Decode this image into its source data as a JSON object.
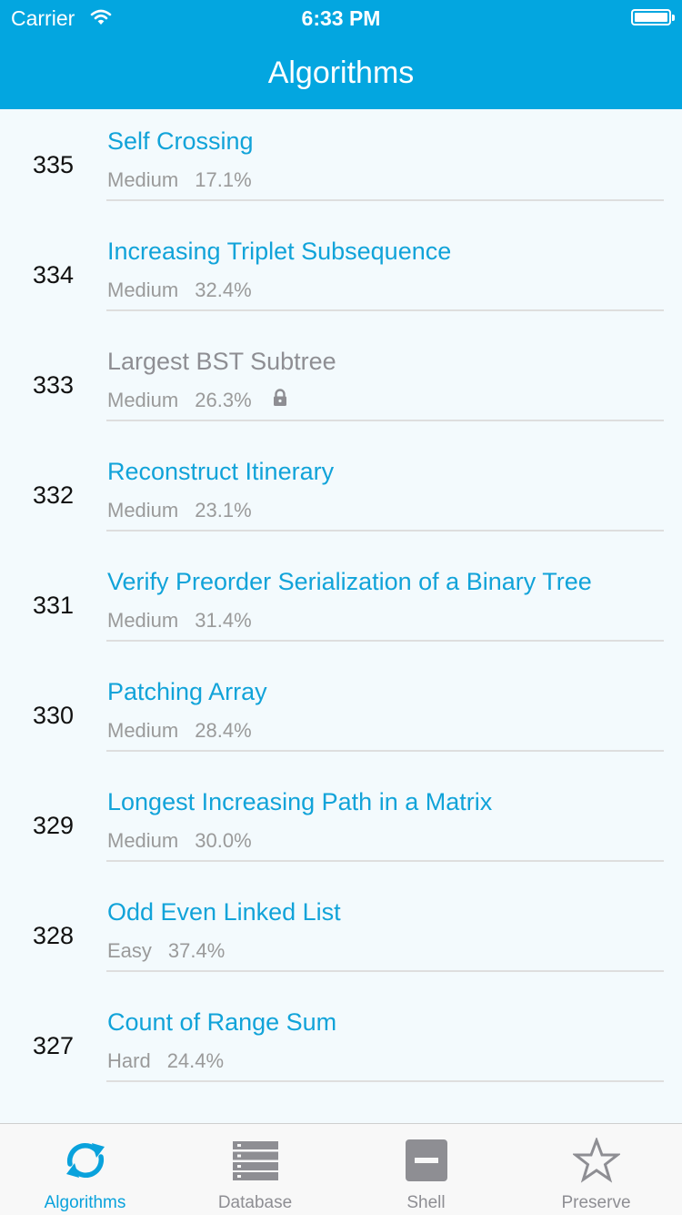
{
  "status_bar": {
    "carrier": "Carrier",
    "time": "6:33 PM"
  },
  "nav": {
    "title": "Algorithms"
  },
  "problems": [
    {
      "id": "335",
      "title": "Self Crossing",
      "difficulty": "Medium",
      "acceptance": "17.1%",
      "locked": false
    },
    {
      "id": "334",
      "title": "Increasing Triplet Subsequence",
      "difficulty": "Medium",
      "acceptance": "32.4%",
      "locked": false
    },
    {
      "id": "333",
      "title": "Largest BST Subtree",
      "difficulty": "Medium",
      "acceptance": "26.3%",
      "locked": true
    },
    {
      "id": "332",
      "title": "Reconstruct Itinerary",
      "difficulty": "Medium",
      "acceptance": "23.1%",
      "locked": false
    },
    {
      "id": "331",
      "title": "Verify Preorder Serialization of a Binary Tree",
      "difficulty": "Medium",
      "acceptance": "31.4%",
      "locked": false
    },
    {
      "id": "330",
      "title": "Patching Array",
      "difficulty": "Medium",
      "acceptance": "28.4%",
      "locked": false
    },
    {
      "id": "329",
      "title": "Longest Increasing Path in a Matrix",
      "difficulty": "Medium",
      "acceptance": "30.0%",
      "locked": false
    },
    {
      "id": "328",
      "title": "Odd Even Linked List",
      "difficulty": "Easy",
      "acceptance": "37.4%",
      "locked": false
    },
    {
      "id": "327",
      "title": "Count of Range Sum",
      "difficulty": "Hard",
      "acceptance": "24.4%",
      "locked": false
    }
  ],
  "tabs": [
    {
      "label": "Algorithms",
      "icon": "sync-icon",
      "active": true
    },
    {
      "label": "Database",
      "icon": "database-icon",
      "active": false
    },
    {
      "label": "Shell",
      "icon": "shell-icon",
      "active": false
    },
    {
      "label": "Preserve",
      "icon": "star-icon",
      "active": false
    }
  ],
  "colors": {
    "accent": "#03a6e0",
    "title_link": "#11a3d9",
    "locked_title": "#8e8e93",
    "meta": "#9a9a9a",
    "tab_inactive": "#8e8e93"
  }
}
